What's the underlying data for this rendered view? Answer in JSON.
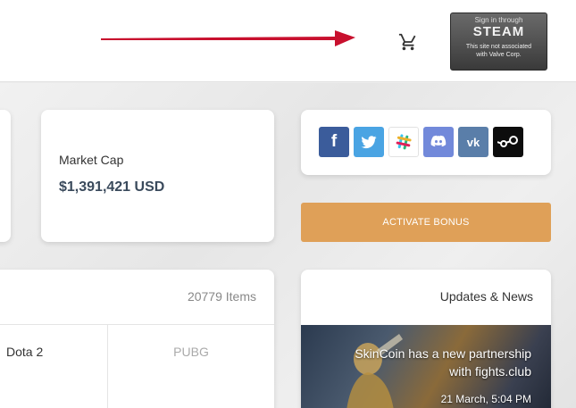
{
  "header": {
    "cart_icon": "shopping-cart-icon",
    "steam_button": {
      "sign_in": "Sign in through",
      "brand": "STEAM",
      "note_line1": "This site not associated",
      "note_line2": "with Valve Corp."
    },
    "arrow_color": "#c8102e"
  },
  "market_cap": {
    "label": "Market Cap",
    "value": "$1,391,421 USD"
  },
  "social": {
    "icons": [
      "facebook-icon",
      "twitter-icon",
      "slack-icon",
      "discord-icon",
      "vk-icon",
      "steam-icon"
    ],
    "fb_glyph": "f",
    "vk_glyph": "vk"
  },
  "bonus": {
    "label": "ACTIVATE BONUS",
    "color": "#dfa058"
  },
  "items": {
    "count": "20779 Items",
    "games": [
      "Dota 2",
      "PUBG"
    ]
  },
  "news": {
    "title": "Updates & News",
    "headline": "SkinCoin has a new partnership with fights.club",
    "date": "21 March, 5:04 PM"
  }
}
